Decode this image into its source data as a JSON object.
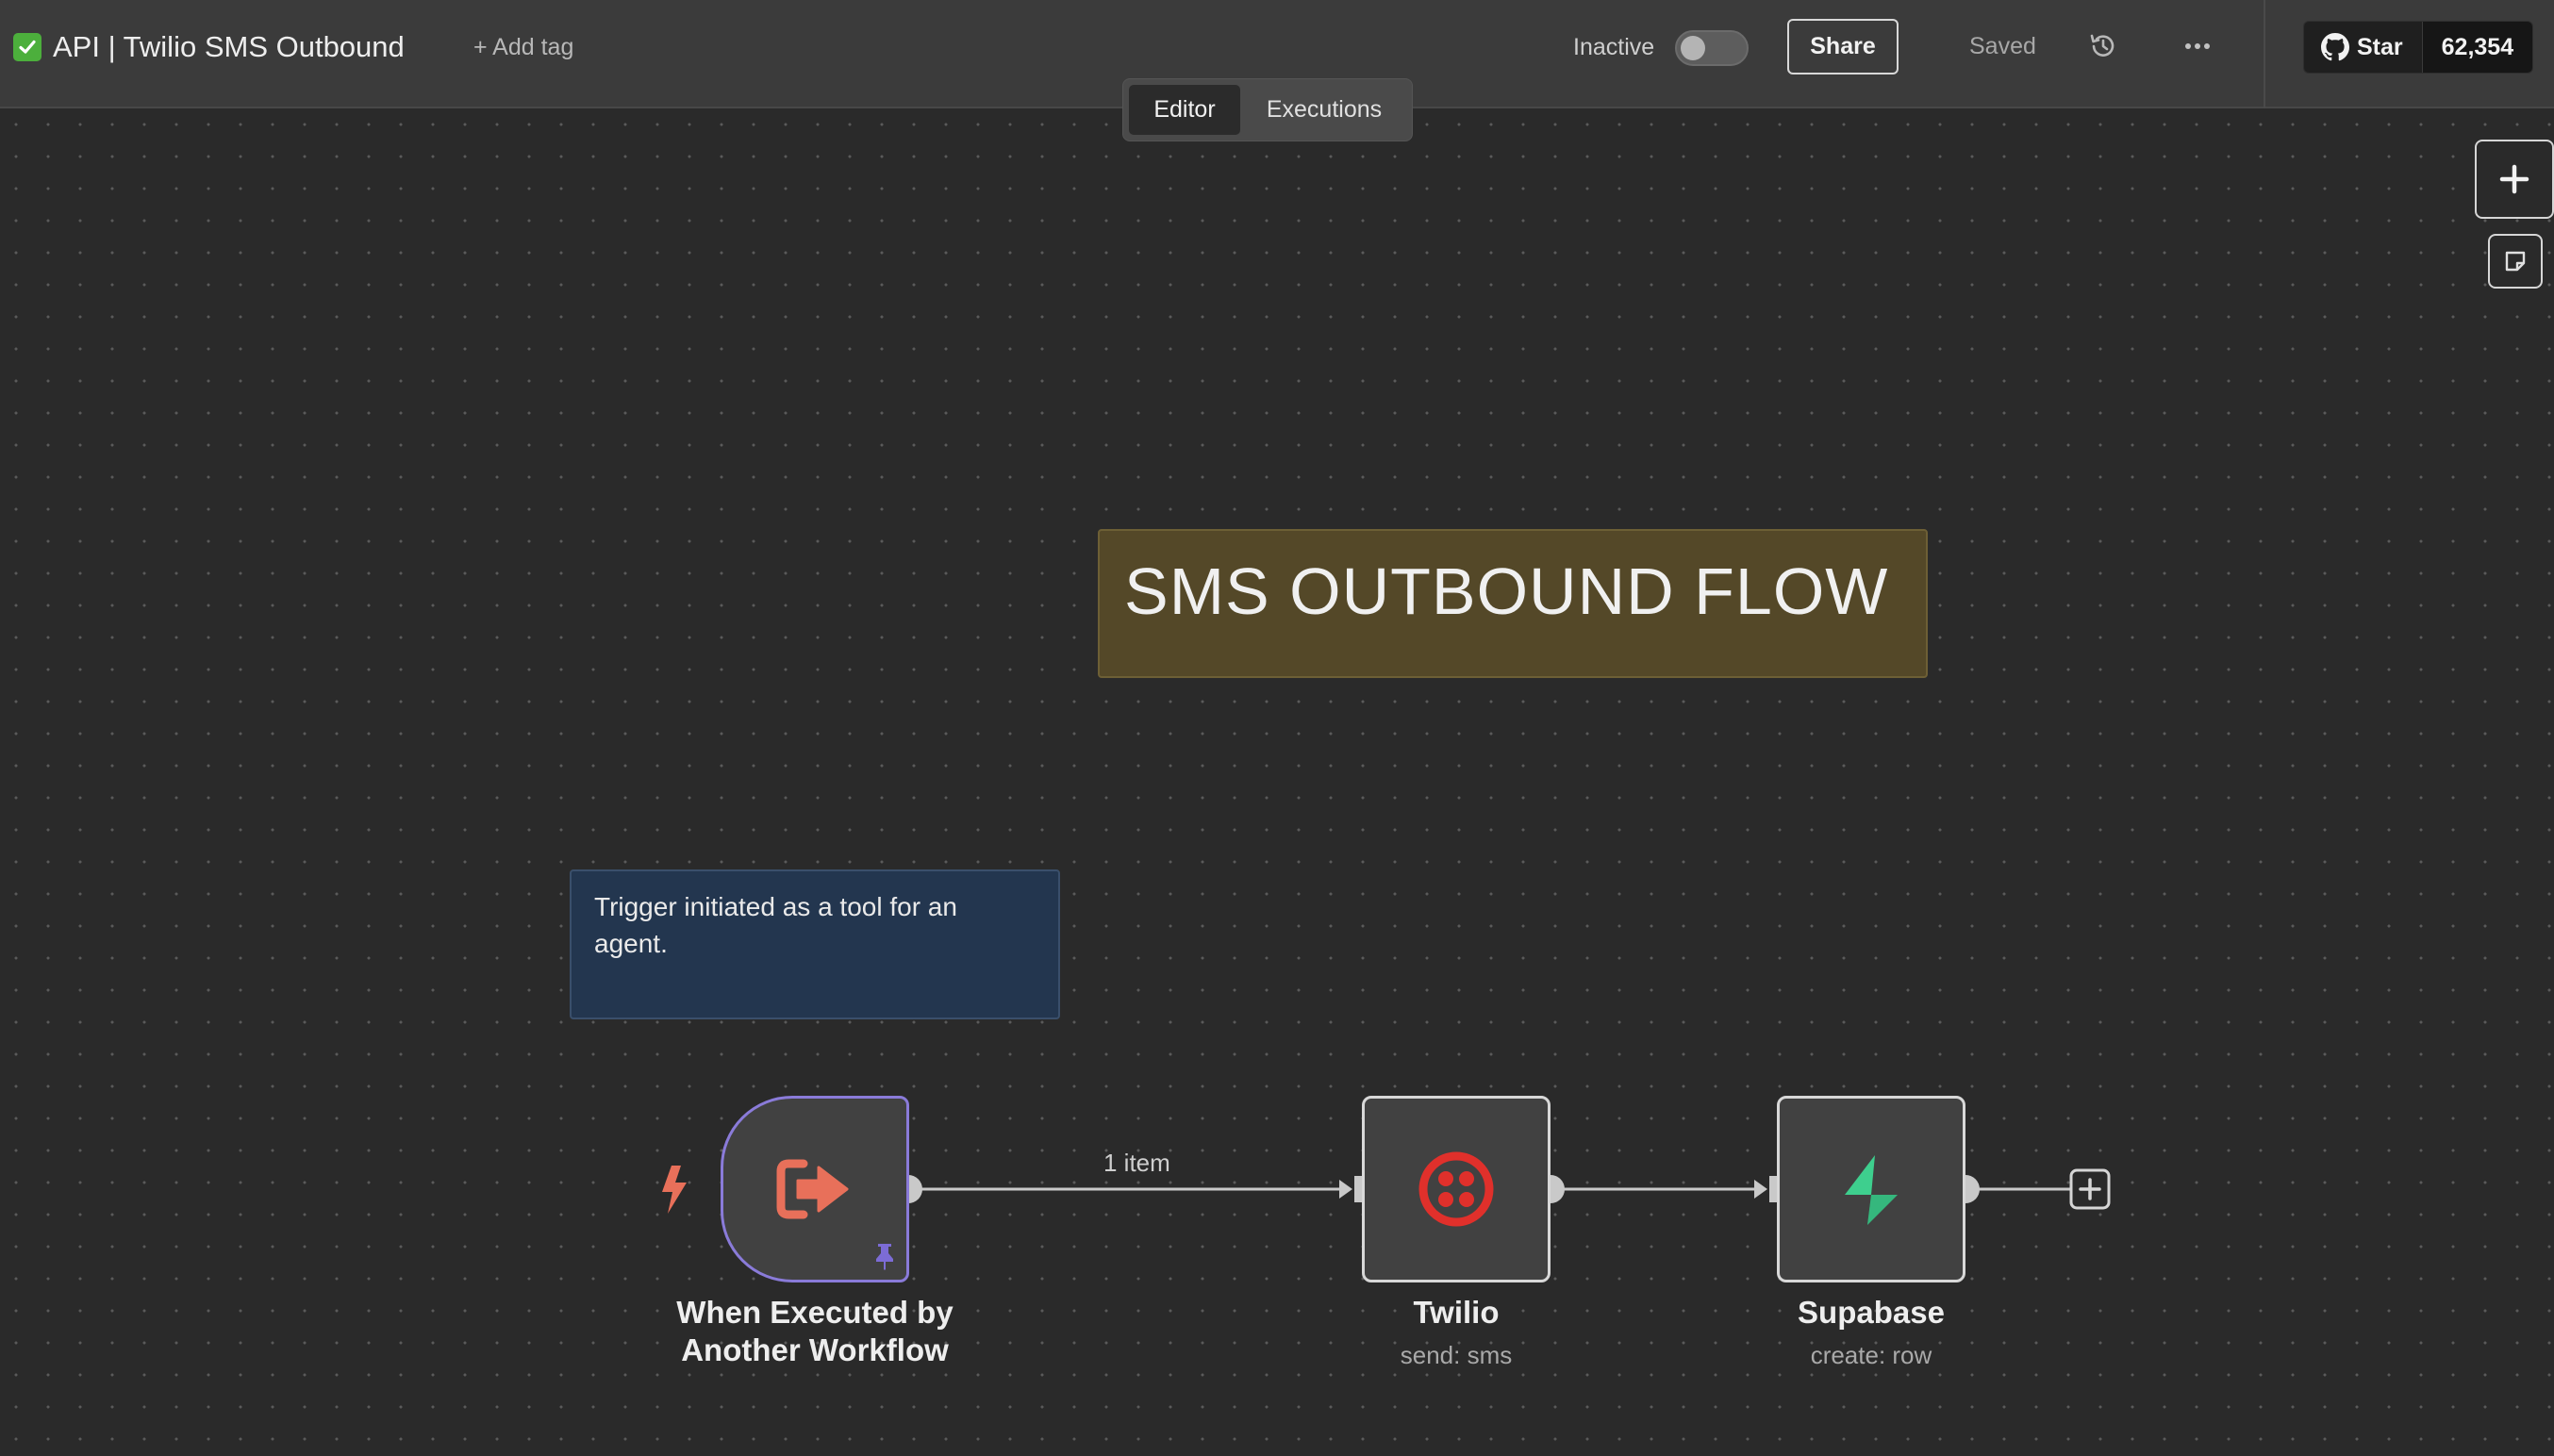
{
  "header": {
    "workflow_title": "API | Twilio SMS Outbound",
    "add_tag_label": "+ Add tag",
    "status_label": "Inactive",
    "share_label": "Share",
    "saved_label": "Saved",
    "github_star_label": "Star",
    "github_star_count": "62,354"
  },
  "tabs": [
    {
      "label": "Editor",
      "active": true
    },
    {
      "label": "Executions",
      "active": false
    }
  ],
  "canvas": {
    "sticky_title": "SMS OUTBOUND FLOW",
    "sticky_note": "Trigger initiated as a tool for an agent.",
    "edge_item_count": "1 item",
    "nodes": [
      {
        "name": "When Executed by Another Workflow",
        "subtitle": "",
        "icon": "exit-arrow-icon",
        "pinned": true
      },
      {
        "name": "Twilio",
        "subtitle": "send: sms",
        "icon": "twilio-icon"
      },
      {
        "name": "Supabase",
        "subtitle": "create: row",
        "icon": "supabase-icon"
      }
    ]
  },
  "colors": {
    "trigger_border": "#8a7bd9",
    "trigger_icon": "#e8705a",
    "twilio": "#e0302b",
    "supabase": "#3ecf8e",
    "sticky_yellow": "#544828",
    "sticky_blue": "#23364f",
    "workflow_active_check": "#4caf3c"
  }
}
